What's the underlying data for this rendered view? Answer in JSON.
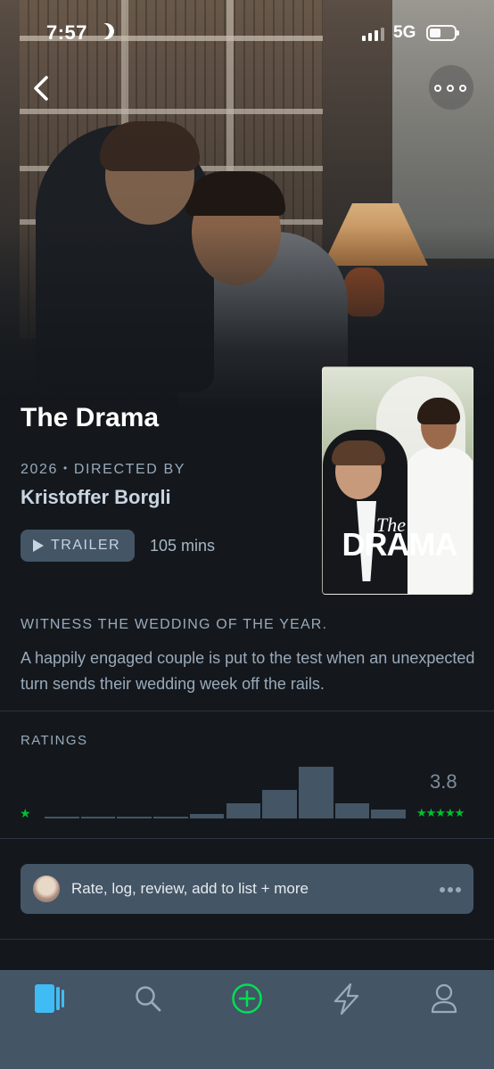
{
  "status_bar": {
    "time": "7:57",
    "network": "5G"
  },
  "film": {
    "title": "The Drama",
    "year": "2026",
    "directed_by_label": "DIRECTED BY",
    "director": "Kristoffer Borgli",
    "trailer_label": "TRAILER",
    "runtime": "105 mins",
    "tagline": "WITNESS THE WEDDING OF THE YEAR.",
    "synopsis": "A happily engaged couple is put to the test when an unexpected turn sends their wedding week off the rails."
  },
  "poster": {
    "small_title": "The",
    "big_title": "DRAMA"
  },
  "ratings": {
    "label": "RATINGS",
    "average": "3.8",
    "low_star": "★",
    "high_stars": "★★★★★",
    "histogram_relative": [
      0.02,
      0.02,
      0.02,
      0.04,
      0.08,
      0.3,
      0.55,
      1.0,
      0.3,
      0.18
    ],
    "bar_color": "#445566",
    "star_color": "#00c030"
  },
  "action_bar": {
    "label": "Rate, log, review, add to list + more"
  },
  "tabs": [
    {
      "name": "films",
      "icon": "films-icon",
      "active": true
    },
    {
      "name": "search",
      "icon": "search-icon",
      "active": false
    },
    {
      "name": "add",
      "icon": "plus-circle-icon",
      "active": false
    },
    {
      "name": "activity",
      "icon": "lightning-icon",
      "active": false
    },
    {
      "name": "profile",
      "icon": "person-icon",
      "active": false
    }
  ],
  "colors": {
    "accent_blue": "#40bcf4",
    "accent_green": "#00e054",
    "tab_icon": "#99aabb"
  }
}
